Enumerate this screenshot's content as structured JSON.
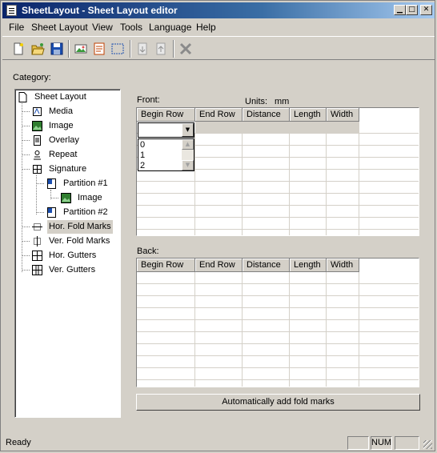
{
  "window": {
    "title": "SheetLayout - Sheet Layout editor"
  },
  "menubar": {
    "file": "File",
    "sheet_layout": "Sheet Layout",
    "view": "View",
    "tools": "Tools",
    "language": "Language",
    "help": "Help"
  },
  "toolbar": {
    "icons": [
      "new-icon",
      "open-icon",
      "save-icon",
      "image-icon",
      "properties-icon",
      "select-icon",
      "move-down-icon",
      "move-up-icon",
      "delete-icon"
    ]
  },
  "category": {
    "label": "Category:",
    "items": [
      {
        "label": "Sheet Layout",
        "icon": "page-icon"
      },
      {
        "label": "Media",
        "icon": "media-icon"
      },
      {
        "label": "Image",
        "icon": "image-icon"
      },
      {
        "label": "Overlay",
        "icon": "overlay-icon"
      },
      {
        "label": "Repeat",
        "icon": "repeat-icon"
      },
      {
        "label": "Signature",
        "icon": "signature-icon"
      },
      {
        "label": "Partition #1",
        "icon": "partition-icon"
      },
      {
        "label": "Image",
        "icon": "image-icon"
      },
      {
        "label": "Partition #2",
        "icon": "partition-icon"
      },
      {
        "label": "Hor. Fold Marks",
        "icon": "hor-fold-marks-icon",
        "selected": true
      },
      {
        "label": "Ver. Fold Marks",
        "icon": "ver-fold-marks-icon"
      },
      {
        "label": "Hor. Gutters",
        "icon": "hor-gutters-icon"
      },
      {
        "label": "Ver. Gutters",
        "icon": "ver-gutters-icon"
      }
    ]
  },
  "front": {
    "label": "Front:",
    "units_label": "Units:",
    "units_value": "mm",
    "columns": [
      "Begin Row",
      "End Row",
      "Distance",
      "Length",
      "Width"
    ],
    "begin_row_value": "",
    "dropdown_options": [
      "0",
      "1",
      "2"
    ]
  },
  "back": {
    "label": "Back:",
    "columns": [
      "Begin Row",
      "End Row",
      "Distance",
      "Length",
      "Width"
    ]
  },
  "auto_button": {
    "label": "Automatically add fold marks"
  },
  "status": {
    "text": "Ready",
    "num": "NUM"
  },
  "colors": {
    "title_start": "#0a246a",
    "title_end": "#a6caf0",
    "face": "#d4d0c8"
  }
}
